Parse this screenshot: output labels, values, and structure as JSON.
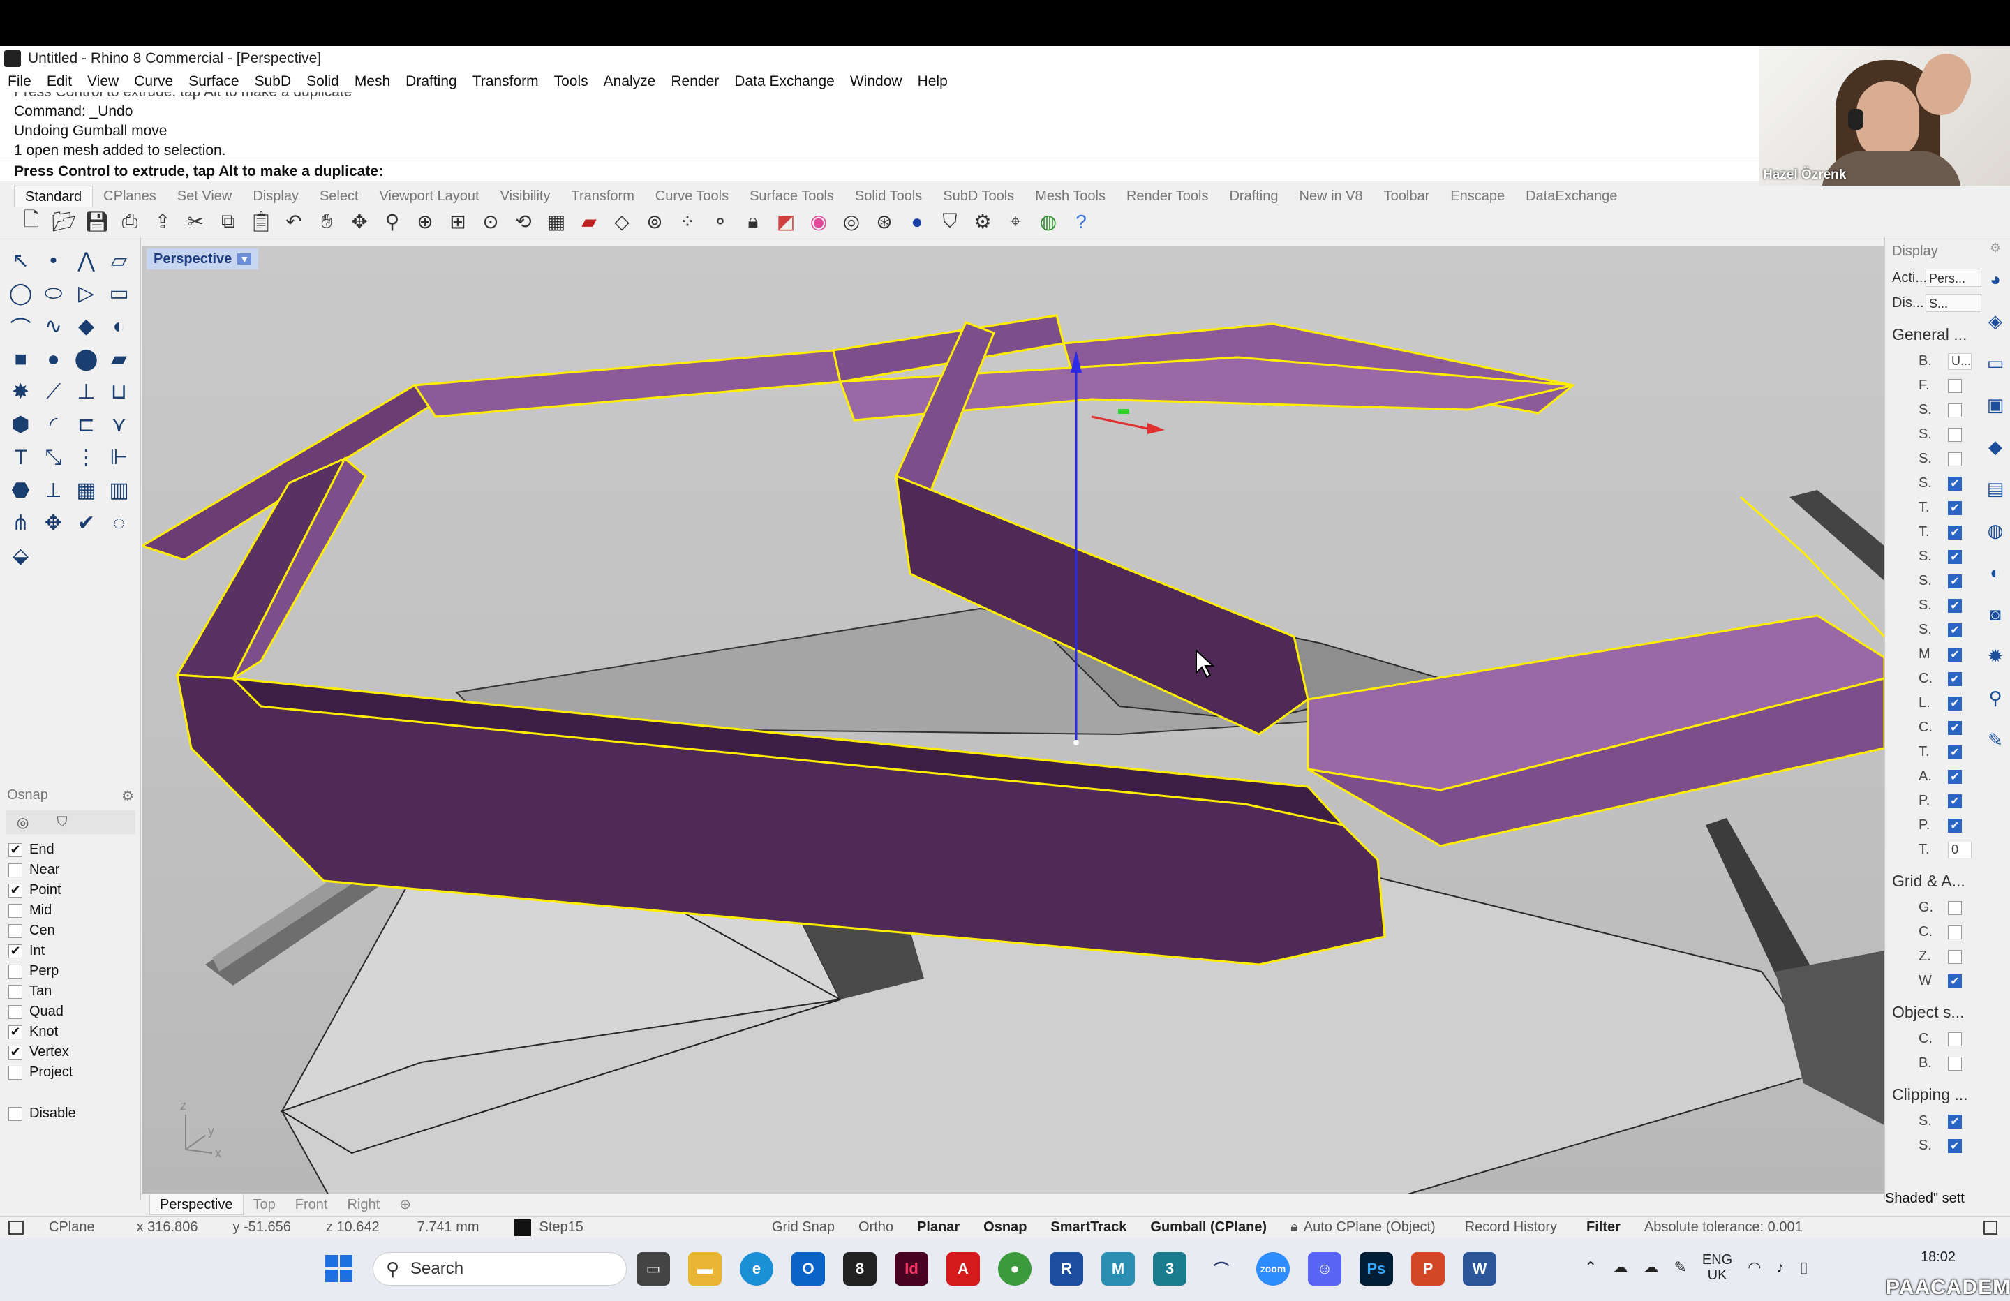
{
  "window": {
    "title": "Untitled - Rhino 8 Commercial - [Perspective]"
  },
  "menu": [
    "File",
    "Edit",
    "View",
    "Curve",
    "Surface",
    "SubD",
    "Solid",
    "Mesh",
    "Drafting",
    "Transform",
    "Tools",
    "Analyze",
    "Render",
    "Data Exchange",
    "Window",
    "Help"
  ],
  "command_history": [
    "Press Control to extrude, tap Alt to make a duplicate",
    "Command: _Undo",
    "Undoing Gumball move",
    "1 open mesh added to selection."
  ],
  "command_prompt": "Press Control to extrude, tap Alt to make a duplicate:",
  "webcam": {
    "name": "Hazel Özrenk"
  },
  "toolbar_tabs": [
    "Standard",
    "CPlanes",
    "Set View",
    "Display",
    "Select",
    "Viewport Layout",
    "Visibility",
    "Transform",
    "Curve Tools",
    "Surface Tools",
    "Solid Tools",
    "SubD Tools",
    "Mesh Tools",
    "Render Tools",
    "Drafting",
    "New in V8",
    "Toolbar",
    "Enscape",
    "DataExchange"
  ],
  "toolbar_icons": [
    "new-icon",
    "open-icon",
    "save-icon",
    "print-icon",
    "export-icon",
    "cut-icon",
    "copy-icon",
    "paste-icon",
    "undo-icon",
    "pan-icon",
    "rotate-view-icon",
    "zoom-icon",
    "zoom-window-icon",
    "zoom-extents-icon",
    "zoom-selected-icon",
    "rotate-icon",
    "grid-icon",
    "car-icon",
    "cplane-icon",
    "osnap-icon",
    "points-icon",
    "light-icon",
    "lock-icon",
    "layer-icon",
    "color-wheel-icon",
    "sphere-wire-icon",
    "sphere-shade-icon",
    "render-sphere-icon",
    "filter-icon",
    "settings-icon",
    "gumball-icon",
    "globe-icon",
    "help-icon"
  ],
  "viewport": {
    "label": "Perspective",
    "tabs": [
      "Perspective",
      "Top",
      "Front",
      "Right"
    ],
    "axis": {
      "z": "z",
      "y": "y",
      "x": "x"
    }
  },
  "osnap": {
    "title": "Osnap",
    "options": [
      {
        "label": "End",
        "checked": true
      },
      {
        "label": "Near",
        "checked": false
      },
      {
        "label": "Point",
        "checked": true
      },
      {
        "label": "Mid",
        "checked": false
      },
      {
        "label": "Cen",
        "checked": false
      },
      {
        "label": "Int",
        "checked": true
      },
      {
        "label": "Perp",
        "checked": false
      },
      {
        "label": "Tan",
        "checked": false
      },
      {
        "label": "Quad",
        "checked": false
      },
      {
        "label": "Knot",
        "checked": true
      },
      {
        "label": "Vertex",
        "checked": true
      },
      {
        "label": "Project",
        "checked": false
      }
    ],
    "disable": "Disable"
  },
  "display_panel": {
    "title": "Display",
    "acti_label": "Acti...",
    "acti_value": "Pers...",
    "dis_label": "Dis...",
    "dis_value": "S...",
    "general_title": "General ...",
    "general_rows": [
      {
        "label": "B.",
        "type": "select",
        "value": "U..."
      },
      {
        "label": "F.",
        "checked": false
      },
      {
        "label": "S.",
        "checked": false
      },
      {
        "label": "S.",
        "checked": false
      },
      {
        "label": "S.",
        "checked": false
      },
      {
        "label": "S.",
        "checked": true
      },
      {
        "label": "T.",
        "checked": true
      },
      {
        "label": "T.",
        "checked": true
      },
      {
        "label": "S.",
        "checked": true
      },
      {
        "label": "S.",
        "checked": true
      },
      {
        "label": "S.",
        "checked": true
      },
      {
        "label": "S.",
        "checked": true
      },
      {
        "label": "M",
        "checked": true
      },
      {
        "label": "C.",
        "checked": true
      },
      {
        "label": "L.",
        "checked": true
      },
      {
        "label": "C.",
        "checked": true
      },
      {
        "label": "T.",
        "checked": true
      },
      {
        "label": "A.",
        "checked": true
      },
      {
        "label": "P.",
        "checked": true
      },
      {
        "label": "P.",
        "checked": true
      },
      {
        "label": "T.",
        "type": "number",
        "value": "0"
      }
    ],
    "grid_title": "Grid & A...",
    "grid_rows": [
      {
        "label": "G.",
        "checked": false
      },
      {
        "label": "C.",
        "checked": false
      },
      {
        "label": "Z.",
        "checked": false
      },
      {
        "label": "W",
        "checked": true
      }
    ],
    "object_title": "Object s...",
    "object_rows": [
      {
        "label": "C.",
        "checked": false
      },
      {
        "label": "B.",
        "checked": false
      }
    ],
    "clipping_title": "Clipping ...",
    "clipping_rows": [
      {
        "label": "S.",
        "checked": true
      },
      {
        "label": "S.",
        "checked": true
      }
    ],
    "footer": "Shaded\" sett"
  },
  "statusbar": {
    "cplane": "CPlane",
    "x": "x 316.806",
    "y": "y -51.656",
    "z": "z 10.642",
    "units": "7.741 mm",
    "layer": "Step15",
    "grid_snap": "Grid Snap",
    "ortho": "Ortho",
    "planar": "Planar",
    "osnap": "Osnap",
    "smarttrack": "SmartTrack",
    "gumball": "Gumball (CPlane)",
    "auto_cplane": "Auto CPlane (Object)",
    "record_history": "Record History",
    "filter": "Filter",
    "tolerance": "Absolute tolerance: 0.001"
  },
  "taskbar": {
    "search_placeholder": "Search",
    "lang_top": "ENG",
    "lang_bottom": "UK",
    "time": "18:02",
    "watermark": "PAACADEMY"
  },
  "colors": {
    "selection_outline": "#ffee00",
    "selected_face": "#7d4f8a",
    "selected_face_dark": "#4f2a57",
    "viewport_bg": "#c4c4c4",
    "accent": "#2a65c4"
  }
}
